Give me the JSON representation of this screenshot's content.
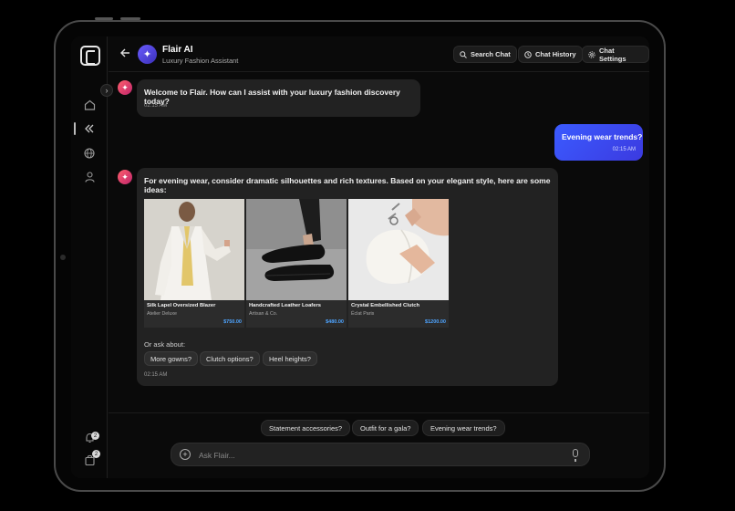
{
  "header": {
    "title": "Flair AI",
    "subtitle": "Luxury Fashion Assistant",
    "buttons": {
      "search": "Search Chat",
      "history": "Chat History",
      "settings": "Chat Settings"
    }
  },
  "sidebar": {
    "items": [
      {
        "icon": "home-icon"
      },
      {
        "icon": "collapse-icon"
      },
      {
        "icon": "globe-icon"
      },
      {
        "icon": "user-icon"
      }
    ],
    "bottom": {
      "notification_badge": "2",
      "bag_badge": "2"
    }
  },
  "messages": {
    "welcome": {
      "text": "Welcome to Flair. How can I assist with your luxury fashion discovery today?",
      "time": "02:15 AM"
    },
    "user": {
      "text": "Evening wear trends?",
      "time": "02:15 AM"
    },
    "reply": {
      "text": "For evening wear, consider dramatic silhouettes and rich textures. Based on your elegant style, here are some ideas:",
      "ask_label": "Or ask about:",
      "chips": [
        "More gowns?",
        "Clutch options?",
        "Heel heights?"
      ],
      "time": "02:15 AM"
    }
  },
  "products": [
    {
      "name": "Silk Lapel Oversized Blazer",
      "brand": "Atelier Deluxe",
      "price": "$750.00"
    },
    {
      "name": "Handcrafted Leather Loafers",
      "brand": "Artisan & Co.",
      "price": "$480.00"
    },
    {
      "name": "Crystal Embellished Clutch",
      "brand": "Éclat Paris",
      "price": "$1200.00"
    }
  ],
  "suggestions": [
    "Statement accessories?",
    "Outfit for a gala?",
    "Evening wear trends?"
  ],
  "input": {
    "placeholder": "Ask Flair..."
  },
  "colors": {
    "accent_blue": "#3b5bff",
    "price_blue": "#4ea4ff",
    "avatar_gradient": "#ff5f6d"
  }
}
